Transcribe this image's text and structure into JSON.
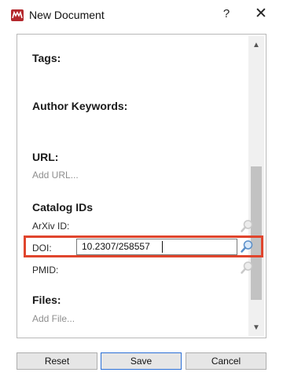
{
  "window": {
    "title": "New Document",
    "help_label": "?",
    "close_label": "✕",
    "app_icon": "mendeley-logo-icon"
  },
  "sections": {
    "tags": {
      "heading": "Tags:"
    },
    "author_keywords": {
      "heading": "Author Keywords:"
    },
    "url": {
      "heading": "URL:",
      "placeholder": "Add URL..."
    },
    "catalog_ids": {
      "heading": "Catalog IDs",
      "arxiv_label": "ArXiv ID:",
      "doi_label": "DOI:",
      "doi_value": "10.2307/258557",
      "pmid_label": "PMID:",
      "lookup_icon": "magnifier-icon"
    },
    "files": {
      "heading": "Files:",
      "placeholder": "Add File..."
    }
  },
  "buttons": {
    "reset": "Reset",
    "save": "Save",
    "cancel": "Cancel"
  },
  "colors": {
    "highlight": "#e0452d",
    "app_icon": "#b4282d",
    "focus_border": "#2b6fd6"
  }
}
